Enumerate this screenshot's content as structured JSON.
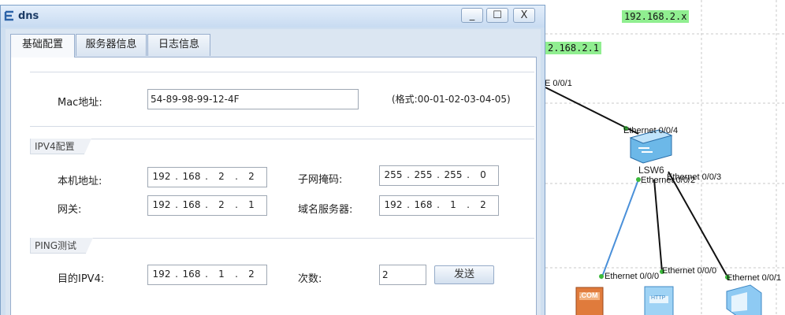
{
  "window": {
    "title": "dns",
    "minimize_symbol": "_",
    "maximize_symbol": "☐",
    "close_symbol": "X"
  },
  "tabs": [
    {
      "label": "基础配置",
      "active": true
    },
    {
      "label": "服务器信息",
      "active": false
    },
    {
      "label": "日志信息",
      "active": false
    }
  ],
  "mac": {
    "label": "Mac地址:",
    "value": "54-89-98-99-12-4F",
    "hint": "(格式:00-01-02-03-04-05)"
  },
  "ipv4": {
    "legend": "IPV4配置",
    "host_label": "本机地址:",
    "host_ip": [
      "192",
      "168",
      "2",
      "2"
    ],
    "mask_label": "子网掩码:",
    "mask": [
      "255",
      "255",
      "255",
      "0"
    ],
    "gateway_label": "网关:",
    "gateway_ip": [
      "192",
      "168",
      "2",
      "1"
    ],
    "dns_label": "域名服务器:",
    "dns_ip": [
      "192",
      "168",
      "1",
      "2"
    ]
  },
  "ping": {
    "legend": "PING测试",
    "target_label": "目的IPV4:",
    "target_ip": [
      "192",
      "168",
      "1",
      "2"
    ],
    "count_label": "次数:",
    "count_value": "2",
    "send_label": "发送"
  },
  "topology": {
    "area_labels": [
      "192.168.2.x",
      "2.168.2.1"
    ],
    "switch_name": "LSW6",
    "port_labels": [
      "E 0/0/1",
      "Ethernet 0/0/4",
      "Ethernet 0/0/3",
      "Ethernet 0/0/2",
      "Ethernet 0/0/0",
      "Ethernet 0/0/0",
      "Ethernet 0/0/1"
    ],
    "server_badge": ".COM",
    "http_badge": "HTTP",
    "line_color": "#111111",
    "link_color": "#4a90d9",
    "port_dot_color": "#3cb93c",
    "area_color": "#90ee90"
  }
}
